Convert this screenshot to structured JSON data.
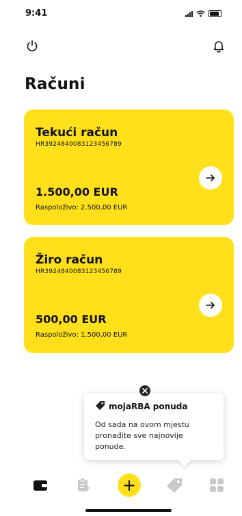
{
  "status": {
    "time": "9:41"
  },
  "header": {
    "title": "Računi"
  },
  "accounts": [
    {
      "name": "Tekući račun",
      "iban": "HR3924840083123456789",
      "balance": "1.500,00 EUR",
      "available": "Raspoloživo: 2.500,00 EUR"
    },
    {
      "name": "Žiro račun",
      "iban": "HR3924840083123456789",
      "balance": "500,00 EUR",
      "available": "Raspoloživo: 1.500,00 EUR"
    }
  ],
  "tooltip": {
    "title": "mojaRBA ponuda",
    "text": "Od sada na ovom mjestu pronađite sve najnovije ponude."
  },
  "nav": {
    "add_symbol": "+"
  },
  "colors": {
    "accent": "#ffe01b",
    "text": "#111111",
    "inactive_icon": "#c8c8c8"
  },
  "icons": [
    "power-icon",
    "bell-icon",
    "arrow-right-icon",
    "tag-icon",
    "close-icon",
    "wallet-icon",
    "clipboard-icon",
    "plus-icon",
    "grid-icon"
  ]
}
